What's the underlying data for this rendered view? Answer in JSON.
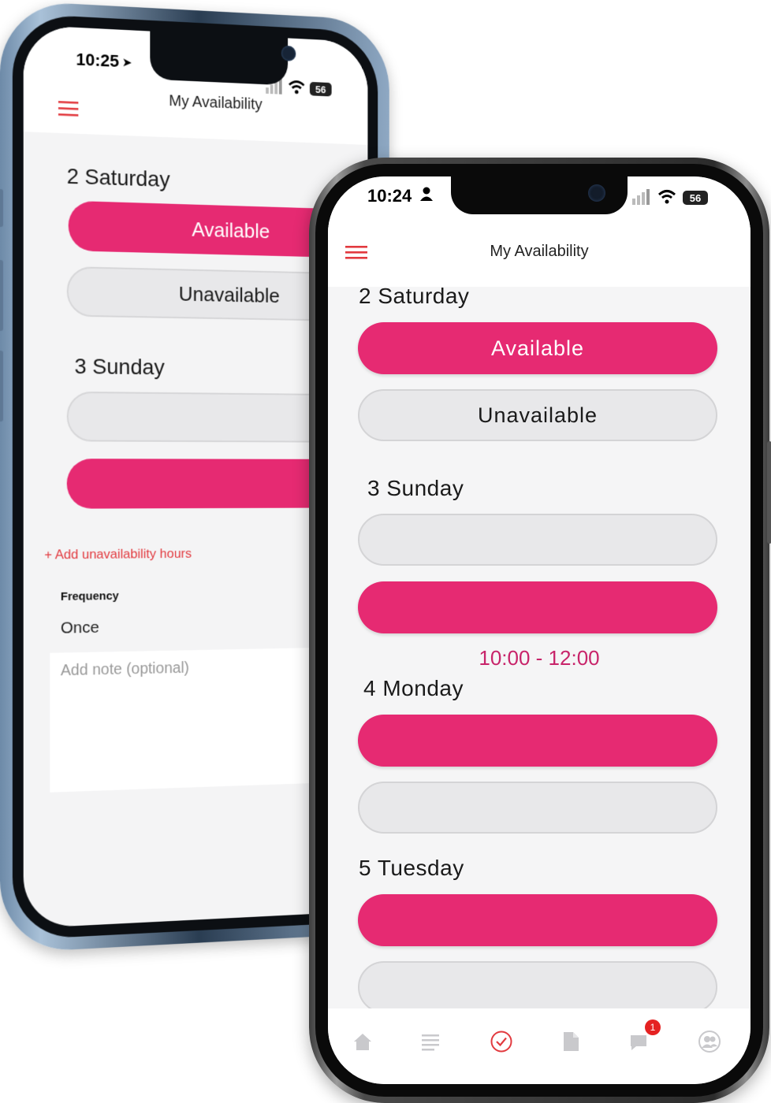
{
  "colors": {
    "brand_pink": "#e62a72",
    "hours_text": "#c8246a",
    "add_link": "#e23a3f"
  },
  "back_phone": {
    "status": {
      "time": "10:25",
      "location_icon": "location-arrow-icon",
      "battery": "56"
    },
    "title": "My Availability",
    "days": [
      {
        "label": "2 Saturday",
        "available_label": "Available",
        "unavailable_label": "Unavailable"
      },
      {
        "label": "3 Sunday"
      }
    ],
    "add_unavailability": "+ Add unavailability hours",
    "frequency": {
      "label": "Frequency",
      "value": "Once"
    },
    "note": {
      "placeholder": "Add note (optional)"
    }
  },
  "front_phone": {
    "status": {
      "time": "10:24",
      "person_icon": "person-icon",
      "battery": "56"
    },
    "title": "My Availability",
    "days": [
      {
        "label": "2 Saturday",
        "available_label": "Available",
        "unavailable_label": "Unavailable"
      },
      {
        "label": "3 Sunday",
        "hours": "10:00 - 12:00"
      },
      {
        "label": "4 Monday"
      },
      {
        "label": "5 Tuesday"
      }
    ],
    "tabbar": [
      {
        "icon": "home-icon"
      },
      {
        "icon": "list-icon"
      },
      {
        "icon": "check-circle-icon",
        "active": true
      },
      {
        "icon": "document-icon"
      },
      {
        "icon": "chat-icon",
        "badge": "1"
      },
      {
        "icon": "profile-icon"
      }
    ]
  }
}
